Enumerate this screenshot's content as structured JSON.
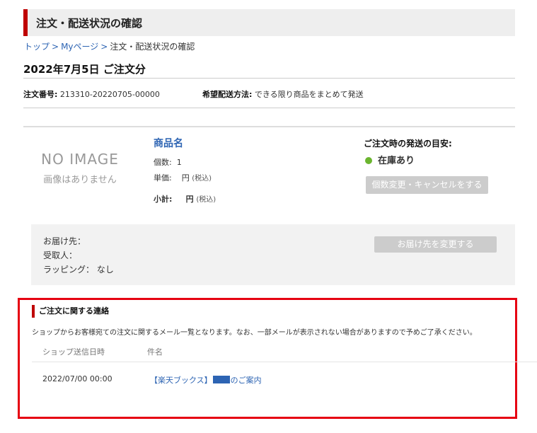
{
  "header": {
    "title": "注文・配送状況の確認"
  },
  "breadcrumb": {
    "top": "トップ",
    "mypage": "Myページ",
    "current": "注文・配送状況の確認",
    "separator": ">"
  },
  "order": {
    "date_title": "2022年7月5日 ご注文分",
    "number_label": "注文番号:",
    "number_value": "213310-20220705-00000",
    "shipping_label": "希望配送方法:",
    "shipping_value": "できる限り商品をまとめて発送"
  },
  "product": {
    "no_image": "NO IMAGE",
    "no_image_sub": "画像はありません",
    "name": "商品名",
    "qty_label": "個数:",
    "qty_value": "1",
    "price_label": "単価:",
    "price_value": "円",
    "tax_note": "(税込)",
    "subtotal_label": "小計:",
    "subtotal_value": "円"
  },
  "shipping_status": {
    "heading": "ご注文時の発送の目安:",
    "status": "在庫あり",
    "status_color": "#6bb52f",
    "change_button": "個数変更・キャンセルをする"
  },
  "delivery": {
    "to_label": "お届け先：",
    "recipient_label": "受取人：",
    "wrapping_label": "ラッピング：",
    "wrapping_value": "なし",
    "change_button": "お届け先を変更する"
  },
  "contact": {
    "heading": "ご注文に関する連絡",
    "description": "ショップからお客様宛ての注文に関するメール一覧となります。なお、一部メールが表示されない場合がありますので予めご了承ください。",
    "columns": [
      "ショップ送信日時",
      "件名"
    ],
    "rows": [
      {
        "date": "2022/07/00 00:00",
        "subject_prefix": "【楽天ブックス】",
        "subject_suffix": "のご案内"
      }
    ],
    "highlight_color": "#e60012"
  }
}
